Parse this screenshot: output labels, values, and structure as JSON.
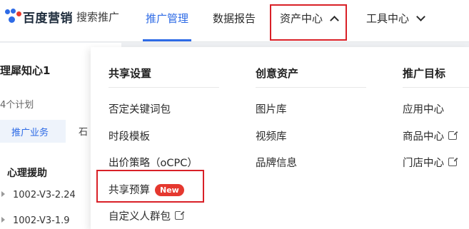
{
  "header": {
    "brand": "百度营销",
    "product": "搜索推广",
    "nav": [
      {
        "label": "推广管理",
        "active": true
      },
      {
        "label": "数据报告",
        "active": false
      },
      {
        "label": "资产中心",
        "active": false,
        "expanded": true
      },
      {
        "label": "工具中心",
        "active": false,
        "expanded": false
      }
    ]
  },
  "left_panel": {
    "title": "理犀知心1",
    "subtitle": "4个计划",
    "tab": "推广业务",
    "tab_edge": "石",
    "section": "心理援助",
    "rows": [
      "1002-V3-2.24",
      "1002-V3-1.9"
    ]
  },
  "dropdown": {
    "columns": [
      {
        "heading": "共享设置",
        "items": [
          {
            "label": "否定关键词包"
          },
          {
            "label": "时段模板"
          },
          {
            "label": "出价策略（oCPC）"
          },
          {
            "label": "共享预算",
            "badge": "New"
          },
          {
            "label": "自定义人群包",
            "external": true
          }
        ]
      },
      {
        "heading": "创意资产",
        "items": [
          {
            "label": "图片库"
          },
          {
            "label": "视频库"
          },
          {
            "label": "品牌信息"
          }
        ]
      },
      {
        "heading": "推广目标",
        "items": [
          {
            "label": "应用中心"
          },
          {
            "label": "商品中心",
            "external": true
          },
          {
            "label": "门店中心",
            "external": true
          }
        ]
      }
    ]
  },
  "colors": {
    "accent": "#2e6be6",
    "highlight": "#d92027",
    "badge": "#e5382f"
  }
}
